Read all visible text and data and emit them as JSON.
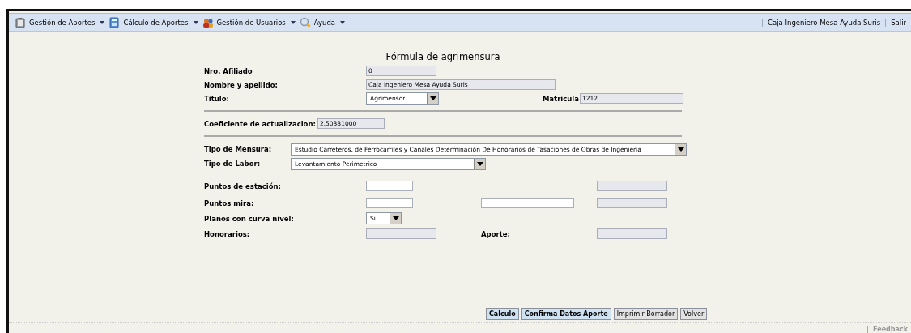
{
  "menu": [
    {
      "label": "Gestión de Aportes"
    },
    {
      "label": "Cálculo de Aportes"
    },
    {
      "label": "Gestión de Usuarios"
    },
    {
      "label": "Ayuda"
    }
  ],
  "user": {
    "name": "Caja Ingeniero Mesa Ayuda Suris",
    "logout": "Salir"
  },
  "form": {
    "title": "Fórmula de agrimensura",
    "rows": [
      {
        "kind": "grid",
        "label": "Nro. Afiliado",
        "fields": [
          {
            "kind": "input",
            "value": "0",
            "readonly": true
          }
        ]
      },
      {
        "kind": "grid",
        "label": "Nombre y apellido:",
        "fields": [
          {
            "kind": "input",
            "value": "Caja Ingeniero Mesa Ayuda Suris",
            "readonly": true
          }
        ]
      },
      {
        "kind": "pair",
        "label": "Título:",
        "fields": [
          {
            "kind": "select",
            "value": "Agrimensor"
          },
          {
            "kind": "label",
            "text": "Matrícula"
          },
          {
            "kind": "input",
            "value": "1212",
            "readonly": true
          }
        ]
      },
      {
        "kind": "rule"
      },
      {
        "kind": "inline",
        "label": "Coeficiente de actualizacion:",
        "fields": [
          {
            "kind": "input",
            "value": "2.50381000",
            "readonly": true
          }
        ]
      },
      {
        "kind": "rule"
      },
      {
        "kind": "wide",
        "label": "Tipo de Mensura:",
        "fields": [
          {
            "kind": "select",
            "value": "Estudio Carreteros, de Ferrocarriles y Canales Determinación De Honorarios de Tasaciones de Obras de Ingeniería"
          }
        ]
      },
      {
        "kind": "wide",
        "label": "Tipo de Labor:",
        "fields": [
          {
            "kind": "select",
            "value": "Levantamiento Perimetrico"
          }
        ]
      },
      {
        "kind": "grid",
        "label": "Puntos de estación:",
        "fields": [
          {
            "kind": "input",
            "readonly": false
          },
          {
            "kind": "empty"
          },
          {
            "kind": "input",
            "readonly": true
          }
        ]
      },
      {
        "kind": "grid",
        "label": "Puntos mira:",
        "fields": [
          {
            "kind": "input",
            "readonly": false
          },
          {
            "kind": "input",
            "readonly": false
          },
          {
            "kind": "input",
            "readonly": true
          }
        ]
      },
      {
        "kind": "grid",
        "label": "Planos con curva nivel:",
        "fields": [
          {
            "kind": "select",
            "value": "Si"
          }
        ]
      },
      {
        "kind": "grid",
        "label": "Honorarios:",
        "fields": [
          {
            "kind": "input",
            "readonly": true
          },
          {
            "kind": "label",
            "text": "Aporte:"
          },
          {
            "kind": "input",
            "readonly": true
          }
        ]
      }
    ]
  },
  "buttons": [
    {
      "label": "Calculo",
      "kind": "primary"
    },
    {
      "label": "Confirma Datos Aporte",
      "kind": "primary"
    },
    {
      "label": "Imprimir Borrador",
      "kind": "secondary"
    },
    {
      "label": "Volver",
      "kind": "secondary"
    }
  ],
  "footer": {
    "feedback": "Feedback"
  }
}
